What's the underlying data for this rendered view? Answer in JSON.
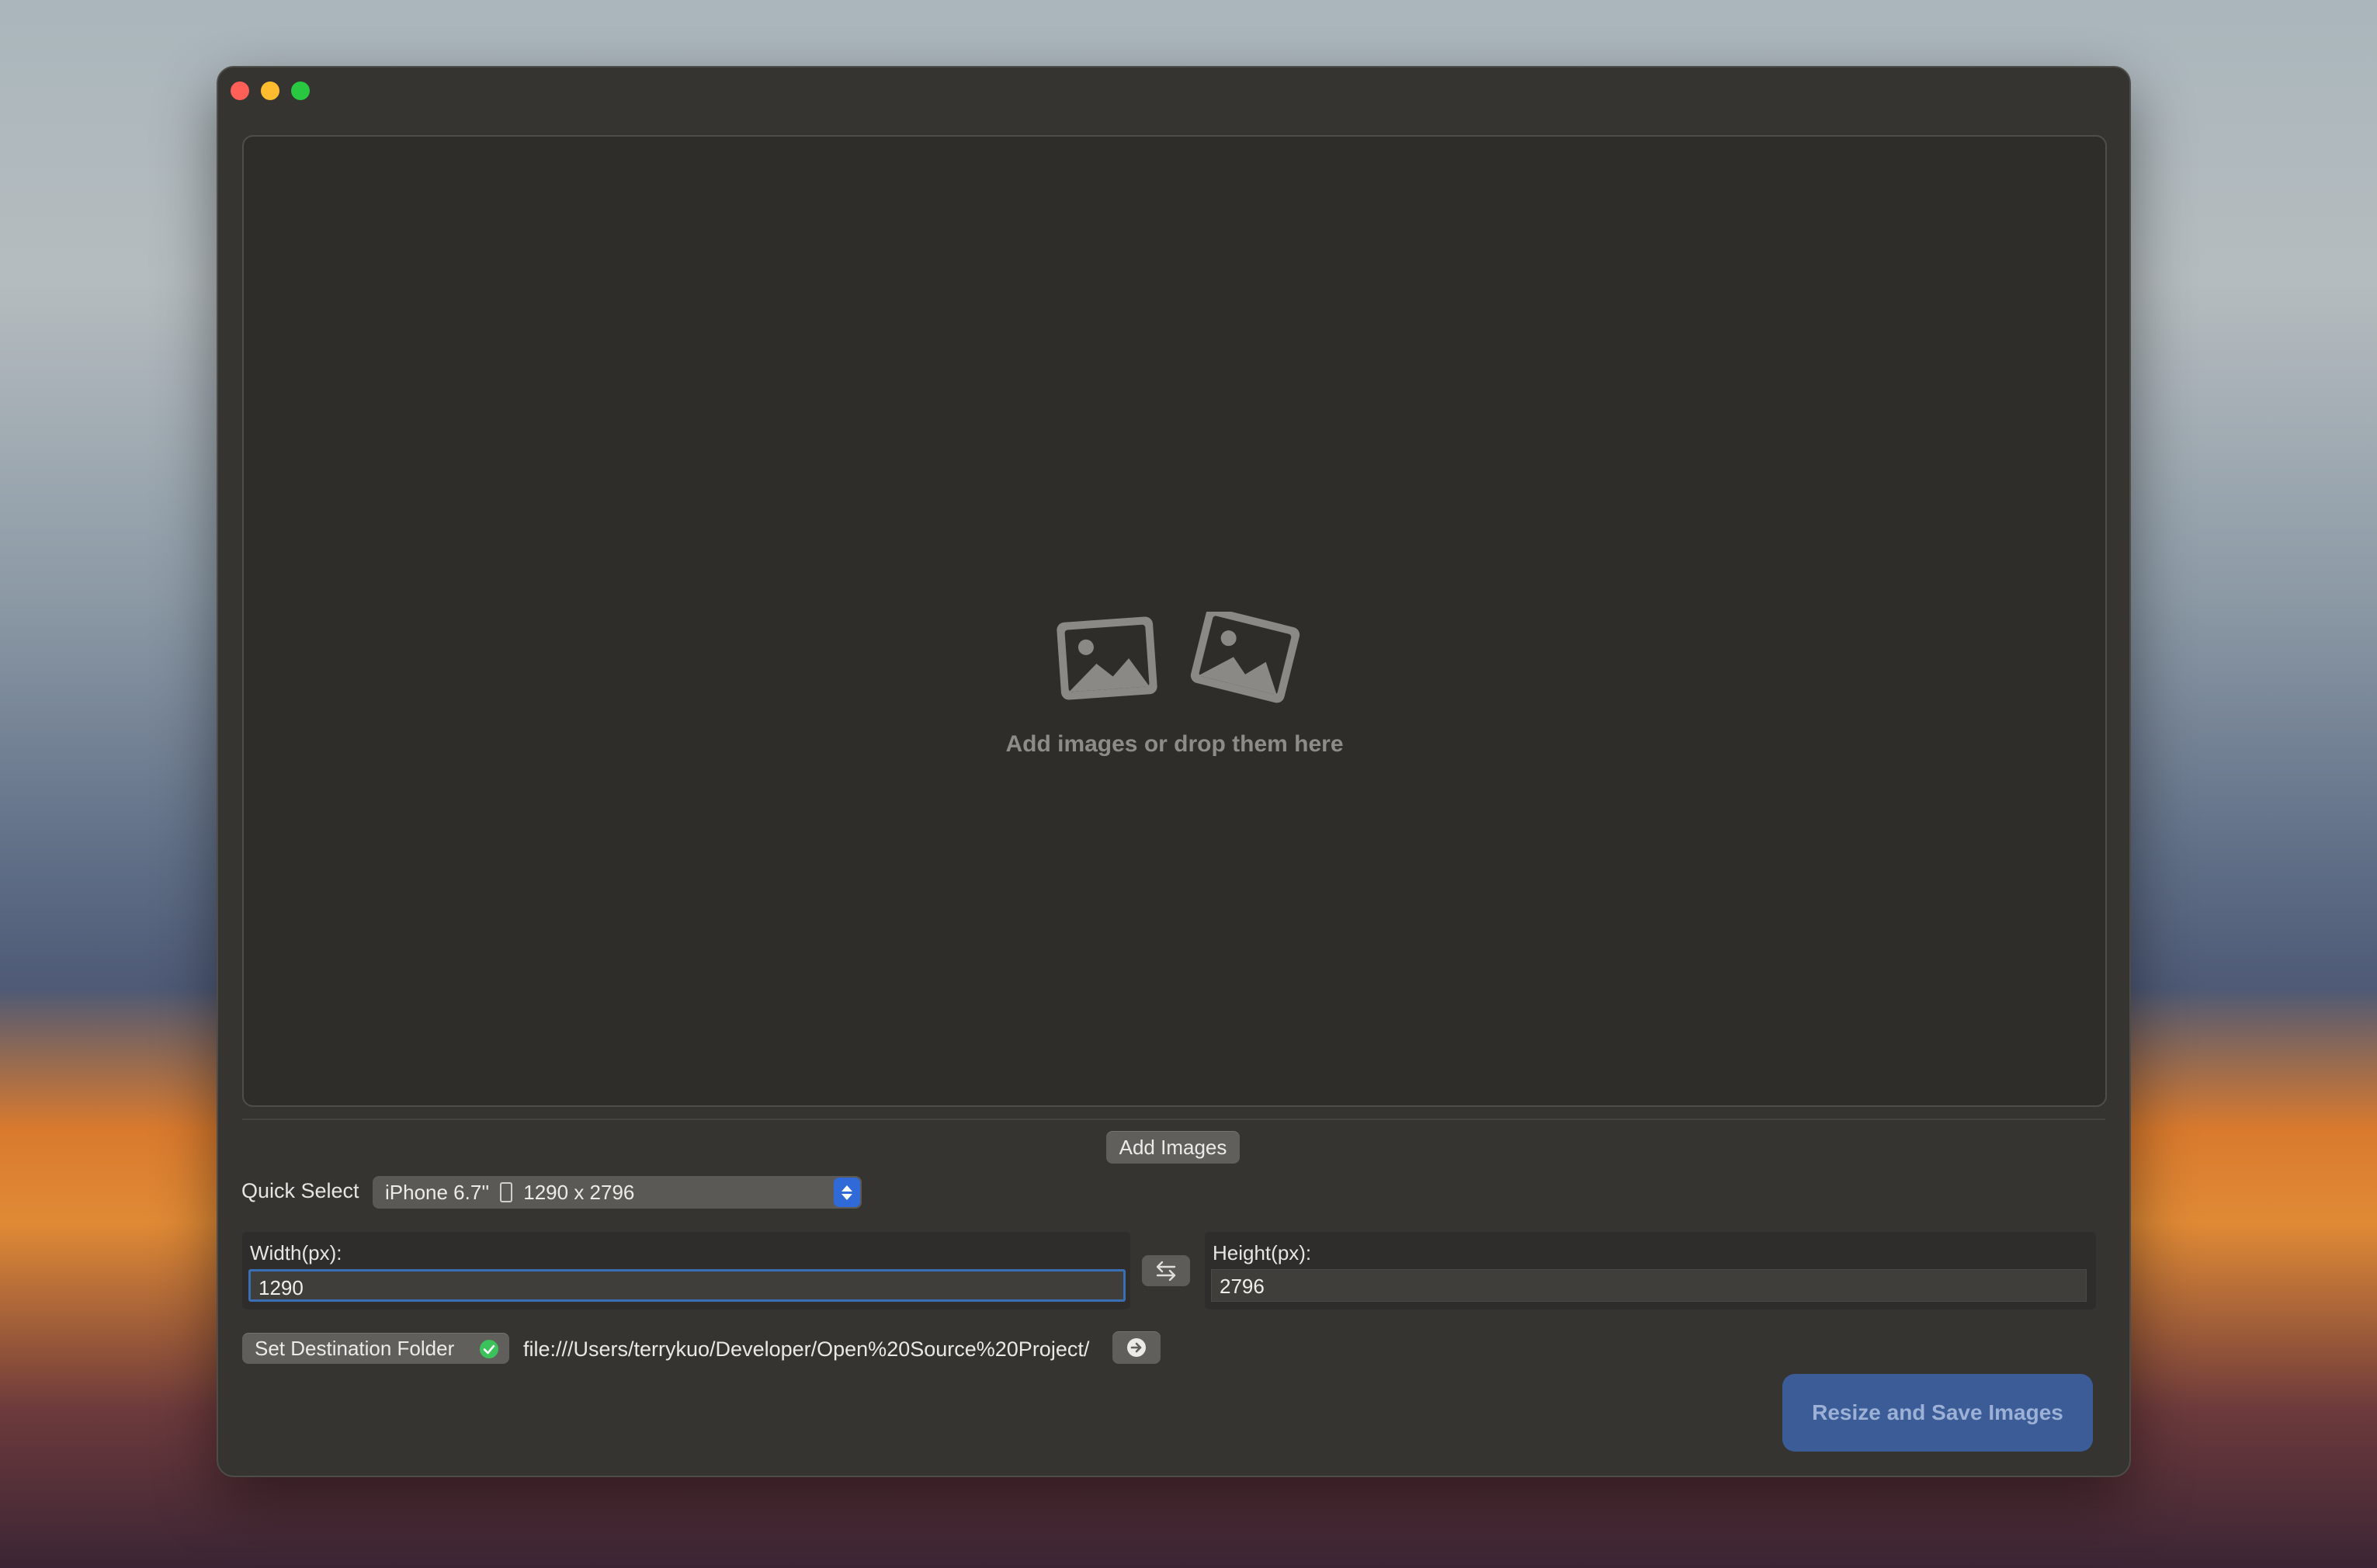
{
  "window": {
    "controls": [
      "close",
      "minimize",
      "zoom"
    ]
  },
  "dropzone": {
    "icon": "photo-stack-icon",
    "message": "Add images or drop them here"
  },
  "toolbar": {
    "add_images_label": "Add Images"
  },
  "quick_select": {
    "label": "Quick Select",
    "selected_device": "iPhone 6.7''",
    "selected_size": "1290 x 2796"
  },
  "dimensions": {
    "width_label": "Width(px):",
    "width_value": "1290",
    "height_label": "Height(px):",
    "height_value": "2796",
    "swap_icon": "swap-arrows-icon"
  },
  "destination": {
    "button_label": "Set Destination Folder",
    "status_icon": "checkmark-circle-icon",
    "path": "file:///Users/terrykuo/Developer/Open%20Source%20Project/",
    "open_icon": "arrow-right-circle-icon"
  },
  "actions": {
    "primary_label": "Resize and Save Images"
  },
  "colors": {
    "accent": "#2f6ad8",
    "primary_button": "#3b5c96",
    "success": "#3cc25a"
  }
}
